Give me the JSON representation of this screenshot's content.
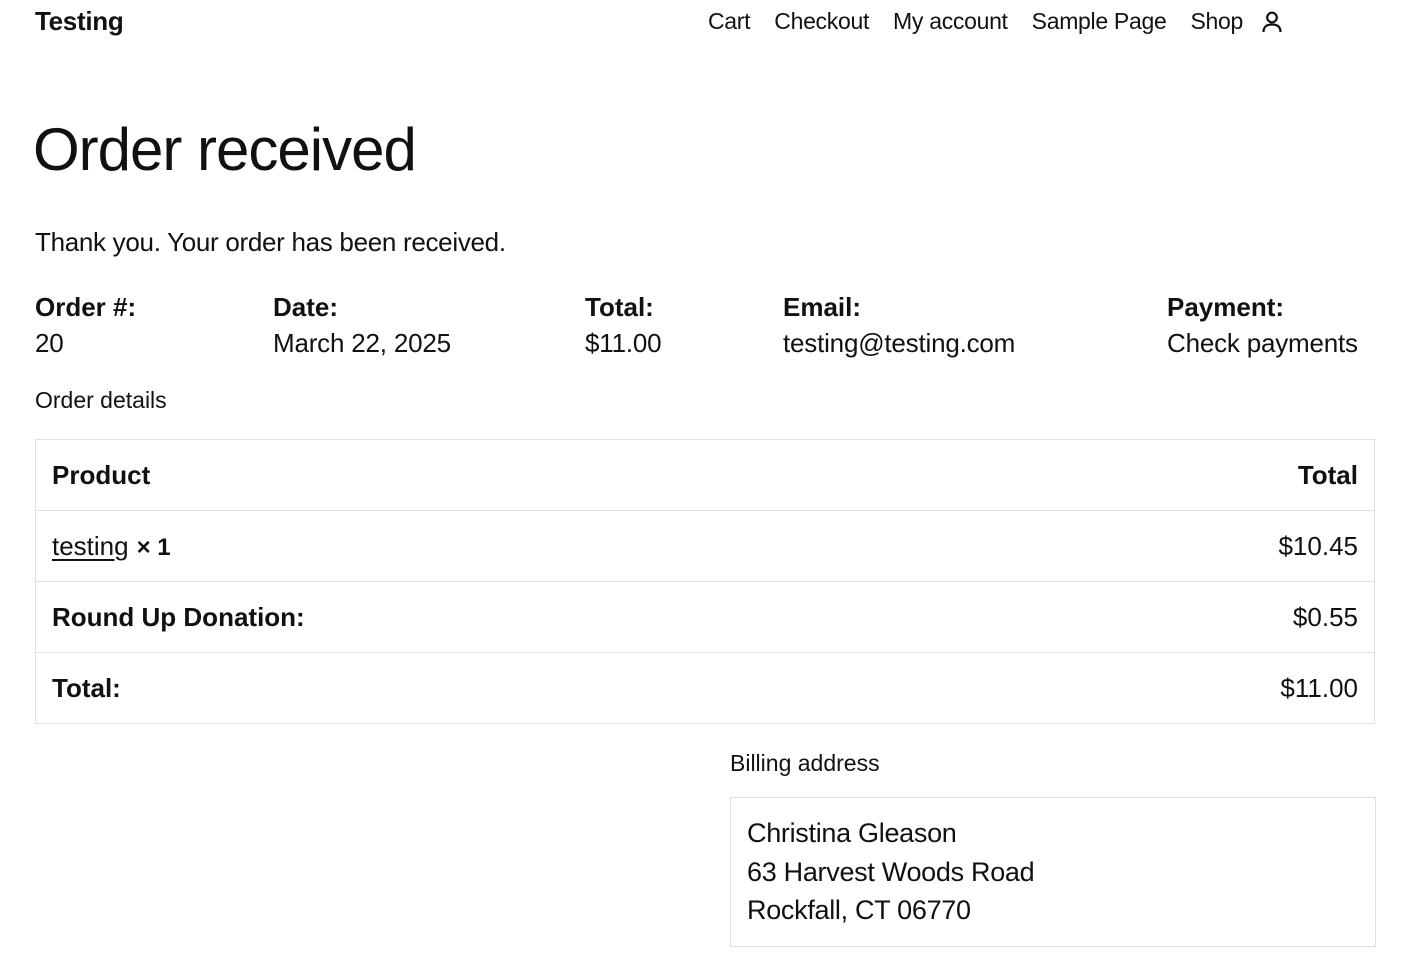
{
  "site": {
    "title": "Testing"
  },
  "nav": {
    "items": [
      "Cart",
      "Checkout",
      "My account",
      "Sample Page",
      "Shop"
    ],
    "account_icon": "user-icon"
  },
  "page": {
    "title": "Order received",
    "thank_you": "Thank you. Your order has been received."
  },
  "overview": {
    "order_label": "Order #:",
    "order_value": "20",
    "date_label": "Date:",
    "date_value": "March 22, 2025",
    "total_label": "Total:",
    "total_value": "$11.00",
    "email_label": "Email:",
    "email_value": "testing@testing.com",
    "payment_label": "Payment:",
    "payment_value": "Check payments"
  },
  "details": {
    "heading": "Order details",
    "columns": [
      "Product",
      "Total"
    ],
    "item": {
      "name": "testing",
      "qty": "× 1",
      "total": "$10.45"
    },
    "donation": {
      "label": "Round Up Donation:",
      "value": "$0.55"
    },
    "grand_total": {
      "label": "Total:",
      "value": "$11.00"
    }
  },
  "billing": {
    "heading": "Billing address",
    "lines": [
      "Christina Gleason",
      "63 Harvest Woods Road",
      "Rockfall, CT 06770"
    ]
  }
}
